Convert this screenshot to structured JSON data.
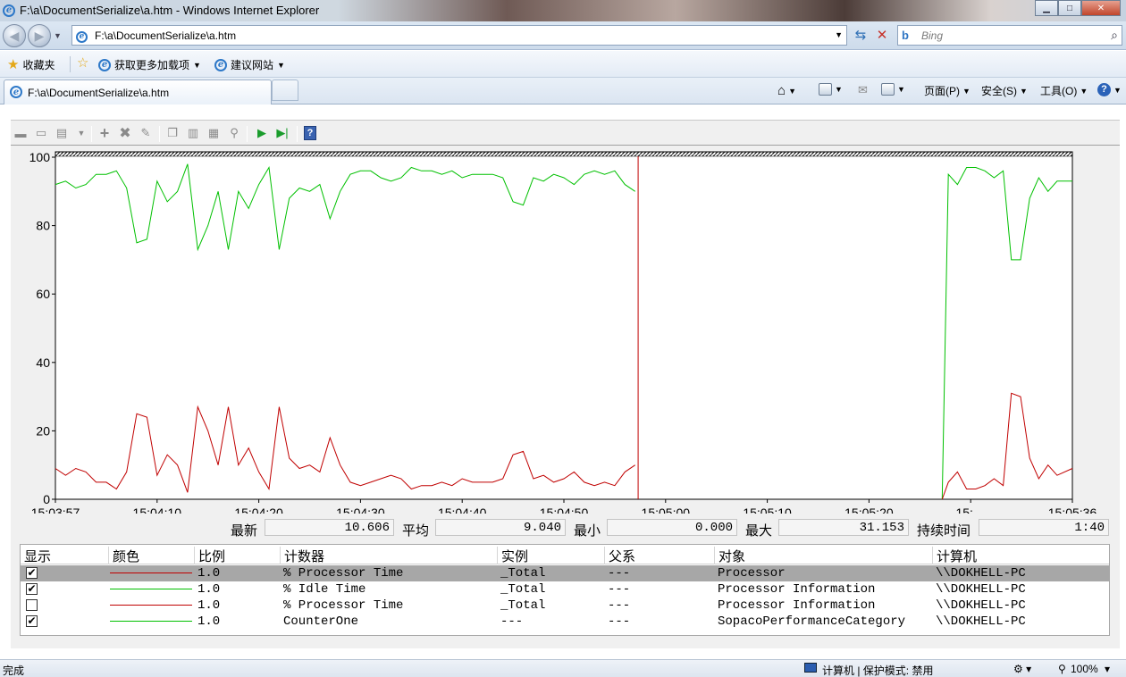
{
  "window": {
    "title": "F:\\a\\DocumentSerialize\\a.htm - Windows Internet Explorer",
    "buttons": {
      "minimize": "▁",
      "maximize": "□",
      "close": "✕"
    }
  },
  "address": {
    "url": "F:\\a\\DocumentSerialize\\a.htm",
    "search_placeholder": "Bing",
    "search_engine": "b"
  },
  "favorites_bar": {
    "favorites_label": "收藏夹",
    "addons_label": "获取更多加载项",
    "suggested_label": "建议网站"
  },
  "tabs": [
    {
      "label": "F:\\a\\DocumentSerialize\\a.htm"
    }
  ],
  "command_bar": {
    "page_label": "页面(P)",
    "safety_label": "安全(S)",
    "tools_label": "工具(O)"
  },
  "perfmon": {
    "toolbar_icons": [
      "new-counter-set-icon",
      "clear-display-icon",
      "view-graph-icon",
      "add-counter-icon",
      "delete-counter-icon",
      "highlight-icon",
      "copy-properties-icon",
      "paste-counter-list-icon",
      "properties-icon",
      "zoom-icon",
      "unfreeze-icon",
      "update-data-icon",
      "help-icon"
    ],
    "stats": {
      "last_label": "最新",
      "last_value": "10.606",
      "avg_label": "平均",
      "avg_value": "9.040",
      "min_label": "最小",
      "min_value": "0.000",
      "max_label": "最大",
      "max_value": "31.153",
      "duration_label": "持续时间",
      "duration_value": "1:40"
    },
    "columns": [
      "显示",
      "颜色",
      "比例",
      "计数器",
      "实例",
      "父系",
      "对象",
      "计算机"
    ],
    "counters": [
      {
        "show": true,
        "color": "#c00000",
        "scale": "1.0",
        "counter": "% Processor Time",
        "instance": "_Total",
        "parent": "---",
        "object": "Processor",
        "computer": "\\\\DOKHELL-PC",
        "selected": true
      },
      {
        "show": true,
        "color": "#00c000",
        "scale": "1.0",
        "counter": "% Idle Time",
        "instance": "_Total",
        "parent": "---",
        "object": "Processor Information",
        "computer": "\\\\DOKHELL-PC",
        "selected": false
      },
      {
        "show": false,
        "color": "#c00000",
        "scale": "1.0",
        "counter": "% Processor Time",
        "instance": "_Total",
        "parent": "---",
        "object": "Processor Information",
        "computer": "\\\\DOKHELL-PC",
        "selected": false
      },
      {
        "show": true,
        "color": "#00c000",
        "scale": "1.0",
        "counter": "CounterOne",
        "instance": "---",
        "parent": "---",
        "object": "SopacoPerformanceCategory",
        "computer": "\\\\DOKHELL-PC",
        "selected": false
      }
    ]
  },
  "status": {
    "left": "完成",
    "zone": "计算机 | 保护模式: 禁用",
    "zoom": "100%"
  },
  "chart_data": {
    "type": "line",
    "ylim": [
      0,
      100
    ],
    "yticks": [
      "0",
      "20",
      "40",
      "60",
      "80",
      "100"
    ],
    "xticks": [
      "15:03:57",
      "15:04:10",
      "15:04:20",
      "15:04:30",
      "15:04:40",
      "15:04:50",
      "15:05:00",
      "15:05:10",
      "15:05:20",
      "15:…",
      "15:05:36"
    ],
    "xlim": [
      0,
      100
    ],
    "cursor_x": 57.3,
    "grid": false,
    "series": [
      {
        "color": "#00c000",
        "segments": [
          [
            [
              0,
              92
            ],
            [
              1,
              93
            ],
            [
              2,
              91
            ],
            [
              3,
              92
            ],
            [
              4,
              95
            ],
            [
              5,
              95
            ],
            [
              6,
              96
            ],
            [
              7,
              91
            ],
            [
              8,
              75
            ],
            [
              9,
              76
            ],
            [
              10,
              93
            ],
            [
              11,
              87
            ],
            [
              12,
              90
            ],
            [
              13,
              98
            ],
            [
              14,
              73
            ],
            [
              15,
              80
            ],
            [
              16,
              90
            ],
            [
              17,
              73
            ],
            [
              18,
              90
            ],
            [
              19,
              85
            ],
            [
              20,
              92
            ],
            [
              21,
              97
            ],
            [
              22,
              73
            ],
            [
              23,
              88
            ],
            [
              24,
              91
            ],
            [
              25,
              90
            ],
            [
              26,
              92
            ],
            [
              27,
              82
            ],
            [
              28,
              90
            ],
            [
              29,
              95
            ],
            [
              30,
              96
            ],
            [
              31,
              96
            ],
            [
              32,
              94
            ],
            [
              33,
              93
            ],
            [
              34,
              94
            ],
            [
              35,
              97
            ],
            [
              36,
              96
            ],
            [
              37,
              96
            ],
            [
              38,
              95
            ],
            [
              39,
              96
            ],
            [
              40,
              94
            ],
            [
              41,
              95
            ],
            [
              42,
              95
            ],
            [
              43,
              95
            ],
            [
              44,
              94
            ],
            [
              45,
              87
            ],
            [
              46,
              86
            ],
            [
              47,
              94
            ],
            [
              48,
              93
            ],
            [
              49,
              95
            ],
            [
              50,
              94
            ],
            [
              51,
              92
            ],
            [
              52,
              95
            ],
            [
              53,
              96
            ],
            [
              54,
              95
            ],
            [
              55,
              96
            ],
            [
              56,
              92
            ],
            [
              57,
              90
            ]
          ],
          [
            [
              87.2,
              0
            ],
            [
              87.8,
              95
            ],
            [
              88.7,
              92
            ],
            [
              89.6,
              97
            ],
            [
              90.5,
              97
            ],
            [
              91.4,
              96
            ],
            [
              92.3,
              94
            ],
            [
              93.2,
              96
            ],
            [
              94,
              70
            ],
            [
              94.9,
              70
            ],
            [
              95.8,
              88
            ],
            [
              96.7,
              94
            ],
            [
              97.6,
              90
            ],
            [
              98.5,
              93
            ],
            [
              100,
              93
            ]
          ]
        ]
      },
      {
        "color": "#c00000",
        "segments": [
          [
            [
              0,
              9
            ],
            [
              1,
              7
            ],
            [
              2,
              9
            ],
            [
              3,
              8
            ],
            [
              4,
              5
            ],
            [
              5,
              5
            ],
            [
              6,
              3
            ],
            [
              7,
              8
            ],
            [
              8,
              25
            ],
            [
              9,
              24
            ],
            [
              10,
              7
            ],
            [
              11,
              13
            ],
            [
              12,
              10
            ],
            [
              13,
              2
            ],
            [
              14,
              27
            ],
            [
              15,
              20
            ],
            [
              16,
              10
            ],
            [
              17,
              27
            ],
            [
              18,
              10
            ],
            [
              19,
              15
            ],
            [
              20,
              8
            ],
            [
              21,
              3
            ],
            [
              22,
              27
            ],
            [
              23,
              12
            ],
            [
              24,
              9
            ],
            [
              25,
              10
            ],
            [
              26,
              8
            ],
            [
              27,
              18
            ],
            [
              28,
              10
            ],
            [
              29,
              5
            ],
            [
              30,
              4
            ],
            [
              31,
              5
            ],
            [
              32,
              6
            ],
            [
              33,
              7
            ],
            [
              34,
              6
            ],
            [
              35,
              3
            ],
            [
              36,
              4
            ],
            [
              37,
              4
            ],
            [
              38,
              5
            ],
            [
              39,
              4
            ],
            [
              40,
              6
            ],
            [
              41,
              5
            ],
            [
              42,
              5
            ],
            [
              43,
              5
            ],
            [
              44,
              6
            ],
            [
              45,
              13
            ],
            [
              46,
              14
            ],
            [
              47,
              6
            ],
            [
              48,
              7
            ],
            [
              49,
              5
            ],
            [
              50,
              6
            ],
            [
              51,
              8
            ],
            [
              52,
              5
            ],
            [
              53,
              4
            ],
            [
              54,
              5
            ],
            [
              55,
              4
            ],
            [
              56,
              8
            ],
            [
              57,
              10
            ]
          ],
          [
            [
              87.2,
              0
            ],
            [
              87.8,
              5
            ],
            [
              88.7,
              8
            ],
            [
              89.6,
              3
            ],
            [
              90.5,
              3
            ],
            [
              91.4,
              4
            ],
            [
              92.3,
              6
            ],
            [
              93.2,
              4
            ],
            [
              94,
              31
            ],
            [
              94.9,
              30
            ],
            [
              95.8,
              12
            ],
            [
              96.7,
              6
            ],
            [
              97.6,
              10
            ],
            [
              98.5,
              7
            ],
            [
              100,
              9
            ]
          ]
        ]
      }
    ]
  }
}
